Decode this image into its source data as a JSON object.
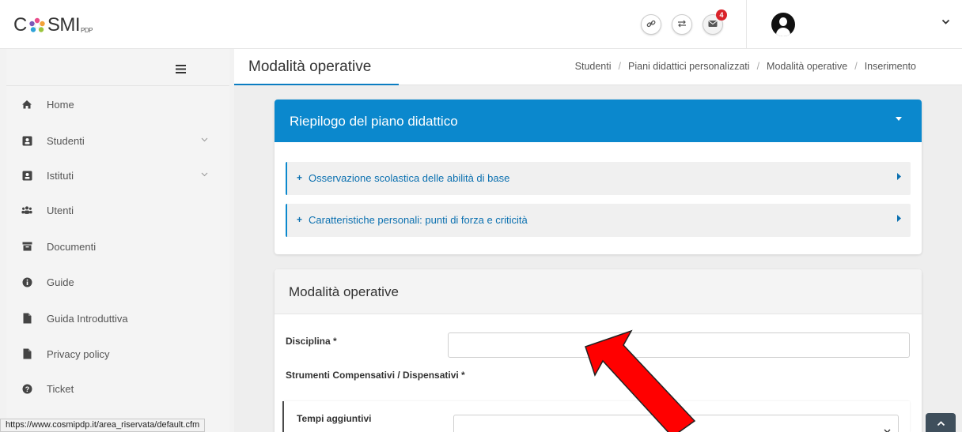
{
  "header": {
    "logo_left": "C",
    "logo_right": "SMI",
    "logo_suffix": "PDP",
    "link_icon": "link-icon",
    "exchange_icon": "exchange-icon",
    "mail_icon": "envelope-icon",
    "mail_count": "4",
    "accent": "#d9232a"
  },
  "sidebar": {
    "items": [
      {
        "label": "Home",
        "icon": "home-icon"
      },
      {
        "label": "Studenti",
        "icon": "student-icon",
        "has_submenu": true
      },
      {
        "label": "Istituti",
        "icon": "institute-icon",
        "has_submenu": true
      },
      {
        "label": "Utenti",
        "icon": "users-icon"
      },
      {
        "label": "Documenti",
        "icon": "archive-icon"
      },
      {
        "label": "Guide",
        "icon": "info-icon"
      },
      {
        "label": "Guida Introduttiva",
        "icon": "file-icon"
      },
      {
        "label": "Privacy policy",
        "icon": "file-icon"
      },
      {
        "label": "Ticket",
        "icon": "question-icon"
      }
    ]
  },
  "page": {
    "title": "Modalità operative",
    "breadcrumb": [
      "Studenti",
      "Piani didattici personalizzati",
      "Modalità operative",
      "Inserimento"
    ],
    "accent": "#0b88cd"
  },
  "summary": {
    "title": "Riepilogo del piano didattico",
    "items": [
      "Osservazione scolastica delle abilità di base",
      "Caratteristiche personali: punti di forza e criticità"
    ]
  },
  "form": {
    "title": "Modalità operative",
    "discipline_label": "Disciplina *",
    "discipline_value": "",
    "tools_label": "Strumenti Compensativi / Dispensativi *",
    "extra_time_label": "Tempi aggiuntivi",
    "extra_time_value": ""
  },
  "status_bar": {
    "url": "https://www.cosmipdp.it/area_riservata/default.cfm"
  }
}
